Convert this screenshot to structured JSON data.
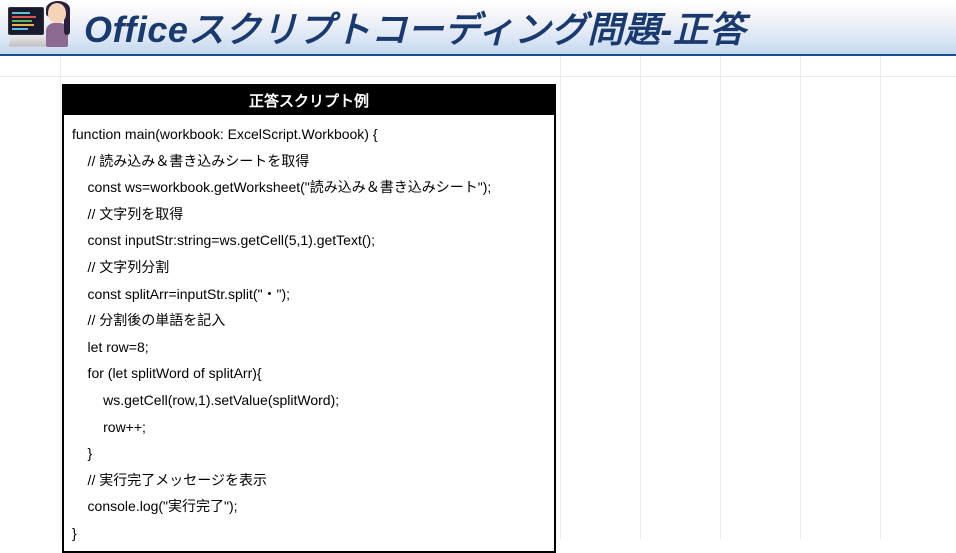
{
  "header": {
    "title": "Officeスクリプトコーディング問題-正答"
  },
  "codebox": {
    "title": "正答スクリプト例",
    "lines": [
      "function main(workbook: ExcelScript.Workbook) {",
      "    // 読み込み＆書き込みシートを取得",
      "    const ws=workbook.getWorksheet(\"読み込み＆書き込みシート\");",
      "    // 文字列を取得",
      "    const inputStr:string=ws.getCell(5,1).getText();",
      "    // 文字列分割",
      "    const splitArr=inputStr.split(\"・\");",
      "    // 分割後の単語を記入",
      "    let row=8;",
      "    for (let splitWord of splitArr){",
      "        ws.getCell(row,1).setValue(splitWord);",
      "        row++;",
      "    }",
      "    // 実行完了メッセージを表示",
      "    console.log(\"実行完了\");",
      "}"
    ]
  }
}
